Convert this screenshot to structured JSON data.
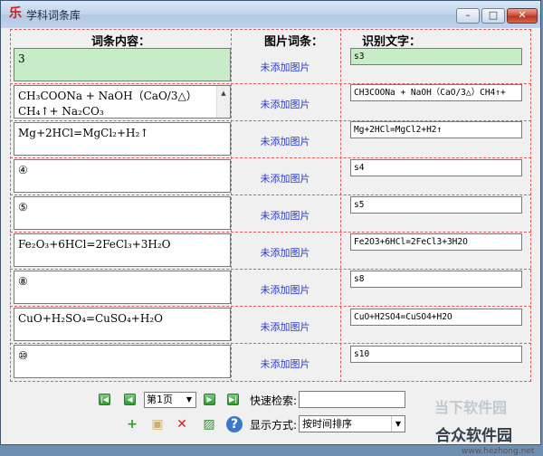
{
  "window": {
    "title": "学科词条库",
    "app_icon": "乐",
    "minimize": "–",
    "maximize": "□",
    "close": "✕"
  },
  "headers": {
    "content": "词条内容：",
    "image": "图片词条：",
    "ocr": "识别文字："
  },
  "rows": [
    {
      "content": "3",
      "image": "未添加图片",
      "ocr": "s3"
    },
    {
      "content": "CH₃COONa + NaOH（CaO/3△）CH₄↑+ Na₂CO₃",
      "image": "未添加图片",
      "ocr": "CH3COONa + NaOH（CaO/3△）CH4↑+"
    },
    {
      "content": "Mg+2HCl=MgCl₂+H₂↑",
      "image": "未添加图片",
      "ocr": "Mg+2HCl=MgCl2+H2↑"
    },
    {
      "content": "④",
      "image": "未添加图片",
      "ocr": "s4"
    },
    {
      "content": "⑤",
      "image": "未添加图片",
      "ocr": "s5"
    },
    {
      "content": "Fe₂O₃+6HCl=2FeCl₃+3H₂O",
      "image": "未添加图片",
      "ocr": "Fe2O3+6HCl=2FeCl3+3H2O"
    },
    {
      "content": "⑧",
      "image": "未添加图片",
      "ocr": "s8"
    },
    {
      "content": "CuO+H₂SO₄=CuSO₄+H₂O",
      "image": "未添加图片",
      "ocr": "CuO+H2SO4=CuSO4+H2O"
    },
    {
      "content": "⑩",
      "image": "未添加图片",
      "ocr": "s10"
    }
  ],
  "pager": {
    "first": "|◀",
    "prev": "◀",
    "next": "▶",
    "last": "▶|",
    "page": "第1页",
    "dropdown": "▼"
  },
  "search": {
    "label": "快速检索:",
    "value": ""
  },
  "toolbar": {
    "add": "+",
    "save": "▣",
    "delete": "✕",
    "image": "▨",
    "help": "?"
  },
  "sort": {
    "label": "显示方式:",
    "value": "按时间排序",
    "dropdown": "▼"
  },
  "watermark": {
    "ghost": "当下软件园",
    "brand": "合众软件园",
    "url": "www.hezhong.net"
  },
  "scroll": {
    "up": "▲",
    "down": "▼"
  },
  "selected_arrow": "➔"
}
